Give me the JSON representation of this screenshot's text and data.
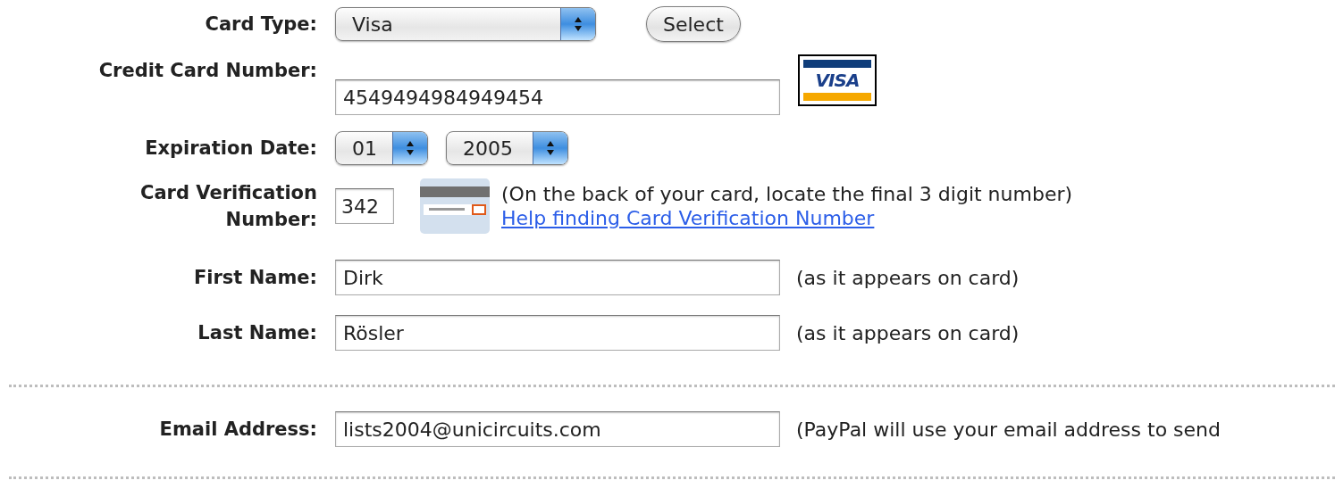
{
  "fields": [
    {
      "kind": "select",
      "label": "Card Type:",
      "value": "Visa",
      "button": "Select"
    },
    {
      "kind": "card_number",
      "label": "Credit Card Number:",
      "value": "4549494984949454",
      "logo_text": "VISA"
    },
    {
      "kind": "date",
      "label": "Expiration Date:",
      "month": "01",
      "year": "2005"
    },
    {
      "kind": "cvv",
      "label": "Card Verification Number:",
      "value": "342",
      "note": "(On the back of your card, locate the final 3 digit number)",
      "link": "Help finding Card Verification Number"
    },
    {
      "kind": "text",
      "label": "First Name:",
      "value": "Dirk",
      "note": "(as it appears on card)"
    },
    {
      "kind": "text",
      "label": "Last Name:",
      "value": "Rösler",
      "note": "(as it appears on card)"
    },
    {
      "kind": "divider"
    },
    {
      "kind": "text",
      "label": "Email Address:",
      "value": "lists2004@unicircuits.com",
      "note": "(PayPal will use your email address to send"
    },
    {
      "kind": "divider"
    }
  ]
}
